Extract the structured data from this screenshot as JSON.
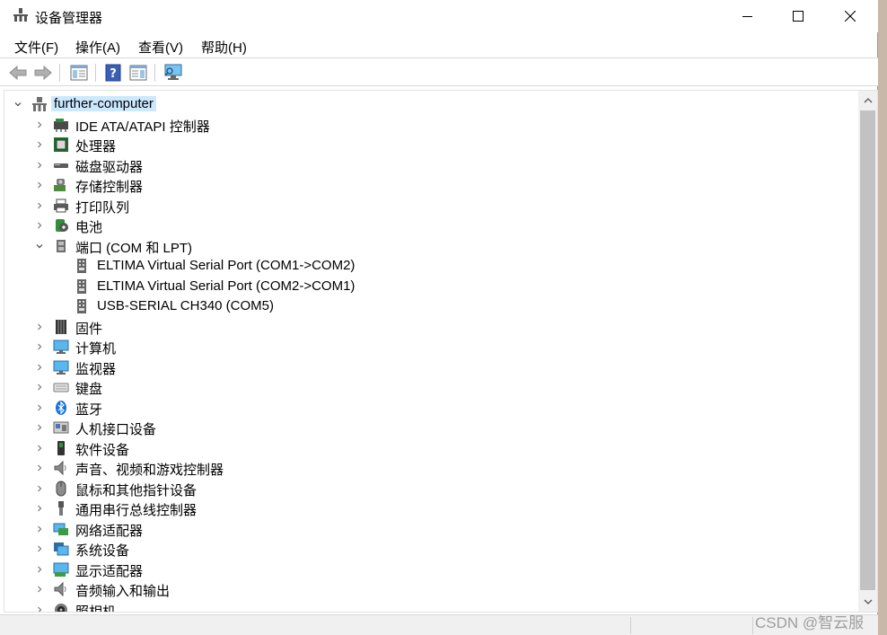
{
  "window": {
    "title": "设备管理器",
    "minimize_label": "—",
    "maximize_label": "☐",
    "close_label": "✕"
  },
  "menu": [
    {
      "label": "文件(F)"
    },
    {
      "label": "操作(A)"
    },
    {
      "label": "查看(V)"
    },
    {
      "label": "帮助(H)"
    }
  ],
  "toolbar": {
    "buttons": [
      "back-icon",
      "forward-icon",
      "properties-icon",
      "help-icon",
      "view-icon",
      "scan-hardware-icon"
    ]
  },
  "tree": {
    "root": {
      "label": "further-computer",
      "icon": "computer-icon"
    },
    "items": [
      {
        "label": "IDE ATA/ATAPI 控制器",
        "icon": "ide-controller-icon",
        "expanded": false
      },
      {
        "label": "处理器",
        "icon": "processor-icon",
        "expanded": false
      },
      {
        "label": "磁盘驱动器",
        "icon": "disk-drive-icon",
        "expanded": false
      },
      {
        "label": "存储控制器",
        "icon": "storage-controller-icon",
        "expanded": false
      },
      {
        "label": "打印队列",
        "icon": "printer-icon",
        "expanded": false
      },
      {
        "label": "电池",
        "icon": "battery-icon",
        "expanded": false
      },
      {
        "label": "端口 (COM 和 LPT)",
        "icon": "port-icon",
        "expanded": true,
        "children": [
          {
            "label": "ELTIMA Virtual Serial Port (COM1->COM2)",
            "icon": "serial-port-icon"
          },
          {
            "label": "ELTIMA Virtual Serial Port (COM2->COM1)",
            "icon": "serial-port-icon"
          },
          {
            "label": "USB-SERIAL CH340 (COM5)",
            "icon": "serial-port-icon"
          }
        ]
      },
      {
        "label": "固件",
        "icon": "firmware-icon",
        "expanded": false
      },
      {
        "label": "计算机",
        "icon": "monitor-icon",
        "expanded": false
      },
      {
        "label": "监视器",
        "icon": "monitor-icon",
        "expanded": false
      },
      {
        "label": "键盘",
        "icon": "keyboard-icon",
        "expanded": false
      },
      {
        "label": "蓝牙",
        "icon": "bluetooth-icon",
        "expanded": false
      },
      {
        "label": "人机接口设备",
        "icon": "hid-icon",
        "expanded": false
      },
      {
        "label": "软件设备",
        "icon": "software-device-icon",
        "expanded": false
      },
      {
        "label": "声音、视频和游戏控制器",
        "icon": "speaker-icon",
        "expanded": false
      },
      {
        "label": "鼠标和其他指针设备",
        "icon": "mouse-icon",
        "expanded": false
      },
      {
        "label": "通用串行总线控制器",
        "icon": "usb-icon",
        "expanded": false
      },
      {
        "label": "网络适配器",
        "icon": "network-adapter-icon",
        "expanded": false
      },
      {
        "label": "系统设备",
        "icon": "system-device-icon",
        "expanded": false
      },
      {
        "label": "显示适配器",
        "icon": "display-adapter-icon",
        "expanded": false
      },
      {
        "label": "音频输入和输出",
        "icon": "speaker-icon",
        "expanded": false
      },
      {
        "label": "照相机",
        "icon": "camera-icon",
        "expanded": false
      }
    ]
  },
  "watermark": "CSDN @智云服",
  "colors": {
    "selection": "#cce8ff",
    "scroll_track": "#f0f0f0",
    "scroll_thumb": "#c2c2c2"
  }
}
